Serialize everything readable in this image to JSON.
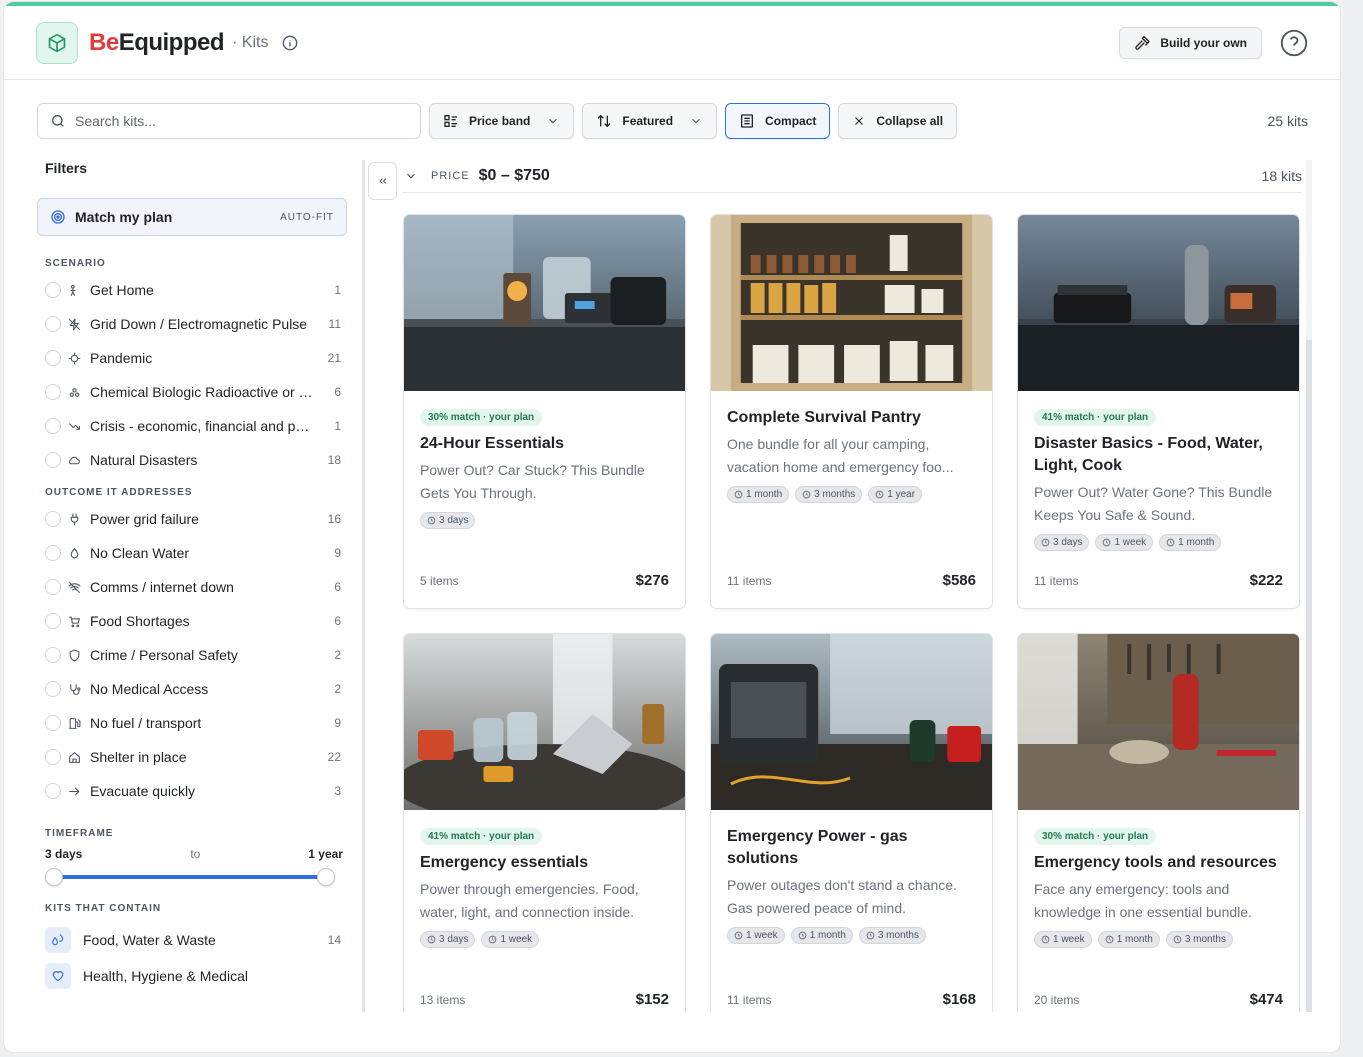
{
  "header": {
    "brand_be": "Be",
    "brand_rest": "Equipped",
    "brand_sub": "· Kits",
    "build_label": "Build your own"
  },
  "toolbar": {
    "search_placeholder": "Search kits...",
    "price_band_label": "Price band",
    "featured_label": "Featured",
    "compact_label": "Compact",
    "collapse_label": "Collapse all",
    "kit_count": "25 kits"
  },
  "sidebar": {
    "filters_title": "Filters",
    "match_label": "Match my plan",
    "match_tag": "AUTO-FIT",
    "scenario_title": "SCENARIO",
    "scenario": [
      {
        "label": "Get Home",
        "count": "1",
        "icon": "person-walk-icon"
      },
      {
        "label": "Grid Down / Electromagnetic Pulse",
        "count": "11",
        "icon": "zap-off-icon"
      },
      {
        "label": "Pandemic",
        "count": "21",
        "icon": "virus-icon"
      },
      {
        "label": "Chemical Biologic Radioactive or Nuclear",
        "count": "6",
        "icon": "biohazard-icon"
      },
      {
        "label": "Crisis - economic, financial and political",
        "count": "1",
        "icon": "trend-down-icon"
      },
      {
        "label": "Natural Disasters",
        "count": "18",
        "icon": "cloud-icon"
      }
    ],
    "outcome_title": "OUTCOME IT ADDRESSES",
    "outcome": [
      {
        "label": "Power grid failure",
        "count": "16",
        "icon": "plug-icon"
      },
      {
        "label": "No Clean Water",
        "count": "9",
        "icon": "droplet-icon"
      },
      {
        "label": "Comms / internet down",
        "count": "6",
        "icon": "wifi-off-icon"
      },
      {
        "label": "Food Shortages",
        "count": "6",
        "icon": "cart-icon"
      },
      {
        "label": "Crime / Personal Safety",
        "count": "2",
        "icon": "shield-icon"
      },
      {
        "label": "No Medical Access",
        "count": "2",
        "icon": "stethoscope-icon"
      },
      {
        "label": "No fuel / transport",
        "count": "9",
        "icon": "fuel-icon"
      },
      {
        "label": "Shelter in place",
        "count": "22",
        "icon": "home-icon"
      },
      {
        "label": "Evacuate quickly",
        "count": "3",
        "icon": "arrow-right-icon"
      }
    ],
    "timeframe_title": "TIMEFRAME",
    "tf_from": "3 days",
    "tf_to_word": "to",
    "tf_until": "1 year",
    "contain_title": "KITS THAT CONTAIN",
    "contain": [
      {
        "label": "Food, Water & Waste",
        "count": "14",
        "icon": "droplets-icon"
      },
      {
        "label": "Health, Hygiene & Medical",
        "count": "",
        "icon": "heart-icon"
      }
    ]
  },
  "group": {
    "price_label": "PRICE",
    "price_range": "$0 – $750",
    "count": "18 kits"
  },
  "cards": [
    {
      "badge": "30% match · your plan",
      "title": "24-Hour Essentials",
      "desc": "Power Out? Car Stuck? This Bundle Gets You Through.",
      "chips": [
        "3 days"
      ],
      "items": "5 items",
      "price": "$276",
      "scene": "kitchen"
    },
    {
      "badge": "",
      "title": "Complete Survival Pantry",
      "desc": "One bundle for all your camping, vacation home and emergency foo...",
      "chips": [
        "1 month",
        "3 months",
        "1 year"
      ],
      "items": "11 items",
      "price": "$586",
      "scene": "pantry"
    },
    {
      "badge": "41% match · your plan",
      "title": "Disaster Basics - Food, Water, Light, Cook",
      "desc": "Power Out? Water Gone? This Bundle Keeps You Safe & Sound.",
      "chips": [
        "3 days",
        "1 week",
        "1 month"
      ],
      "items": "11 items",
      "price": "$222",
      "scene": "stove"
    },
    {
      "badge": "41% match · your plan",
      "title": "Emergency essentials",
      "desc": "Power through emergencies. Food, water, light, and connection inside.",
      "chips": [
        "3 days",
        "1 week"
      ],
      "items": "13 items",
      "price": "$152",
      "scene": "table"
    },
    {
      "badge": "",
      "title": "Emergency Power - gas solutions",
      "desc": "Power outages don't stand a chance. Gas powered peace of mind.",
      "chips": [
        "1 week",
        "1 month",
        "3 months"
      ],
      "items": "11 items",
      "price": "$168",
      "scene": "generator"
    },
    {
      "badge": "30% match · your plan",
      "title": "Emergency tools and resources",
      "desc": "Face any emergency: tools and knowledge in one essential bundle.",
      "chips": [
        "1 week",
        "1 month",
        "3 months"
      ],
      "items": "20 items",
      "price": "$474",
      "scene": "workshop"
    }
  ],
  "colors": {
    "accent": "#2f6fdf",
    "brand_red": "#e23b3b",
    "match_green": "#1d7d4f",
    "top_bar": "#4ecf9a"
  },
  "timeframe_range": {
    "from_fraction": 0,
    "to_fraction": 1
  }
}
